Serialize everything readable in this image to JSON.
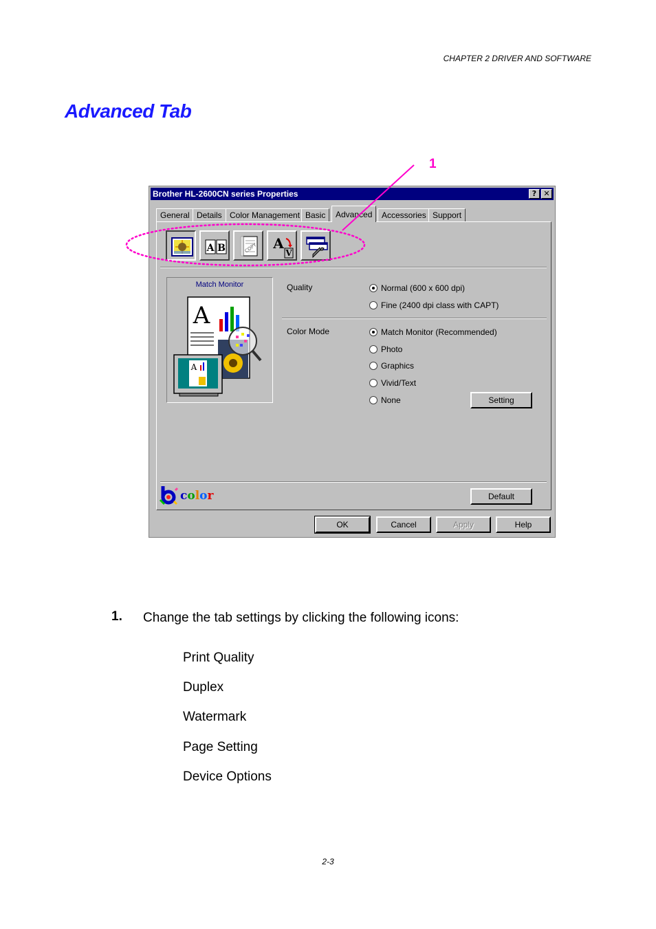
{
  "header": {
    "running_title": "CHAPTER 2 DRIVER AND SOFTWARE",
    "page_title": "Advanced Tab"
  },
  "callout": {
    "number": "1",
    "color": "#ff00cc"
  },
  "dialog": {
    "title": "Brother HL-2600CN series Properties",
    "help_button": "?",
    "close_button": "✕",
    "tabs": [
      {
        "label": "General",
        "active": false
      },
      {
        "label": "Details",
        "active": false
      },
      {
        "label": "Color Management",
        "active": false
      },
      {
        "label": "Basic",
        "active": false
      },
      {
        "label": "Advanced",
        "active": true
      },
      {
        "label": "Accessories",
        "active": false
      },
      {
        "label": "Support",
        "active": false
      }
    ],
    "icon_buttons": [
      {
        "icon": "print-quality-icon",
        "pressed": true
      },
      {
        "icon": "duplex-icon",
        "pressed": false
      },
      {
        "icon": "watermark-icon",
        "pressed": false
      },
      {
        "icon": "page-setting-icon",
        "pressed": false
      },
      {
        "icon": "device-options-icon",
        "pressed": false
      }
    ],
    "preview_label": "Match Monitor",
    "quality": {
      "label": "Quality",
      "options": [
        {
          "label": "Normal (600 x 600 dpi)",
          "selected": true
        },
        {
          "label": "Fine (2400 dpi class with CAPT)",
          "selected": false
        }
      ]
    },
    "color_mode": {
      "label": "Color Mode",
      "options": [
        {
          "label": "Match Monitor (Recommended)",
          "selected": true
        },
        {
          "label": "Photo",
          "selected": false
        },
        {
          "label": "Graphics",
          "selected": false
        },
        {
          "label": "Vivid/Text",
          "selected": false
        },
        {
          "label": "None",
          "selected": false
        }
      ]
    },
    "setting_button": "Setting",
    "logo_text": "color",
    "default_button": "Default",
    "buttons": {
      "ok": "OK",
      "cancel": "Cancel",
      "apply": "Apply",
      "help": "Help"
    },
    "accent_color": "#00007f"
  },
  "body": {
    "step_number": "1.",
    "step_text": "Change the tab settings by clicking the following icons:",
    "icon_list": [
      "Print Quality",
      "Duplex",
      "Watermark",
      "Page Setting",
      "Device Options"
    ]
  },
  "footer": {
    "page_number": "2-3"
  }
}
